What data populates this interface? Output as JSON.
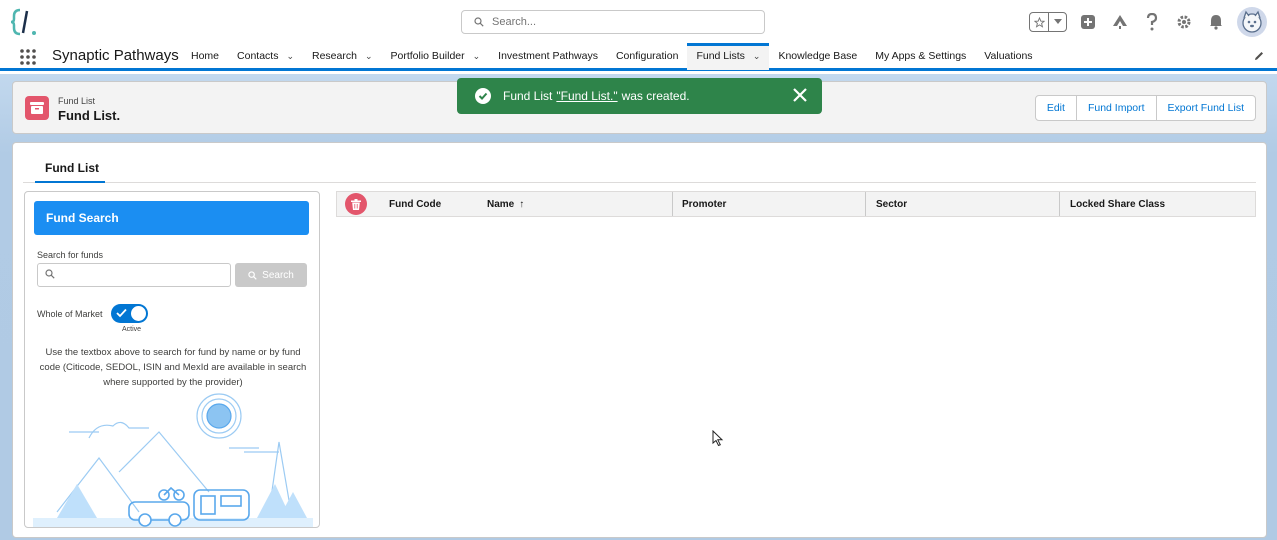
{
  "header": {
    "search_placeholder": "Search..."
  },
  "app": {
    "name": "Synaptic Pathways",
    "nav": [
      {
        "label": "Home",
        "dropdown": false
      },
      {
        "label": "Contacts",
        "dropdown": true
      },
      {
        "label": "Research",
        "dropdown": true
      },
      {
        "label": "Portfolio Builder",
        "dropdown": true
      },
      {
        "label": "Investment Pathways",
        "dropdown": false
      },
      {
        "label": "Configuration",
        "dropdown": false
      },
      {
        "label": "Fund Lists",
        "dropdown": true,
        "active": true
      },
      {
        "label": "Knowledge Base",
        "dropdown": false
      },
      {
        "label": "My Apps & Settings",
        "dropdown": false
      },
      {
        "label": "Valuations",
        "dropdown": false
      }
    ]
  },
  "page_header": {
    "eyebrow": "Fund List",
    "title": "Fund List.",
    "actions": [
      "Edit",
      "Fund Import",
      "Export Fund List"
    ]
  },
  "toast": {
    "prefix": "Fund List",
    "link": "\"Fund List.\"",
    "suffix": "was created.",
    "color": "#2e844a"
  },
  "tabs": {
    "active": "Fund List"
  },
  "fund_search": {
    "title": "Fund Search",
    "search_label": "Search for funds",
    "search_value": "",
    "search_button": "Search",
    "whole_of_market_label": "Whole of Market",
    "whole_of_market_on": true,
    "toggle_state": "Active",
    "help_text": "Use the textbox above to search for fund by name or by fund code (Citicode, SEDOL, ISIN and MexId are available in search where supported by the provider)"
  },
  "table": {
    "columns": {
      "code": "Fund Code",
      "name": "Name",
      "name_sort": "↑",
      "promoter": "Promoter",
      "sector": "Sector",
      "locked": "Locked Share Class"
    },
    "rows": []
  },
  "colors": {
    "brand_blue": "#0176d3",
    "panel_header": "#1b8ef2",
    "record_icon": "#e3566c",
    "success": "#2e844a"
  }
}
